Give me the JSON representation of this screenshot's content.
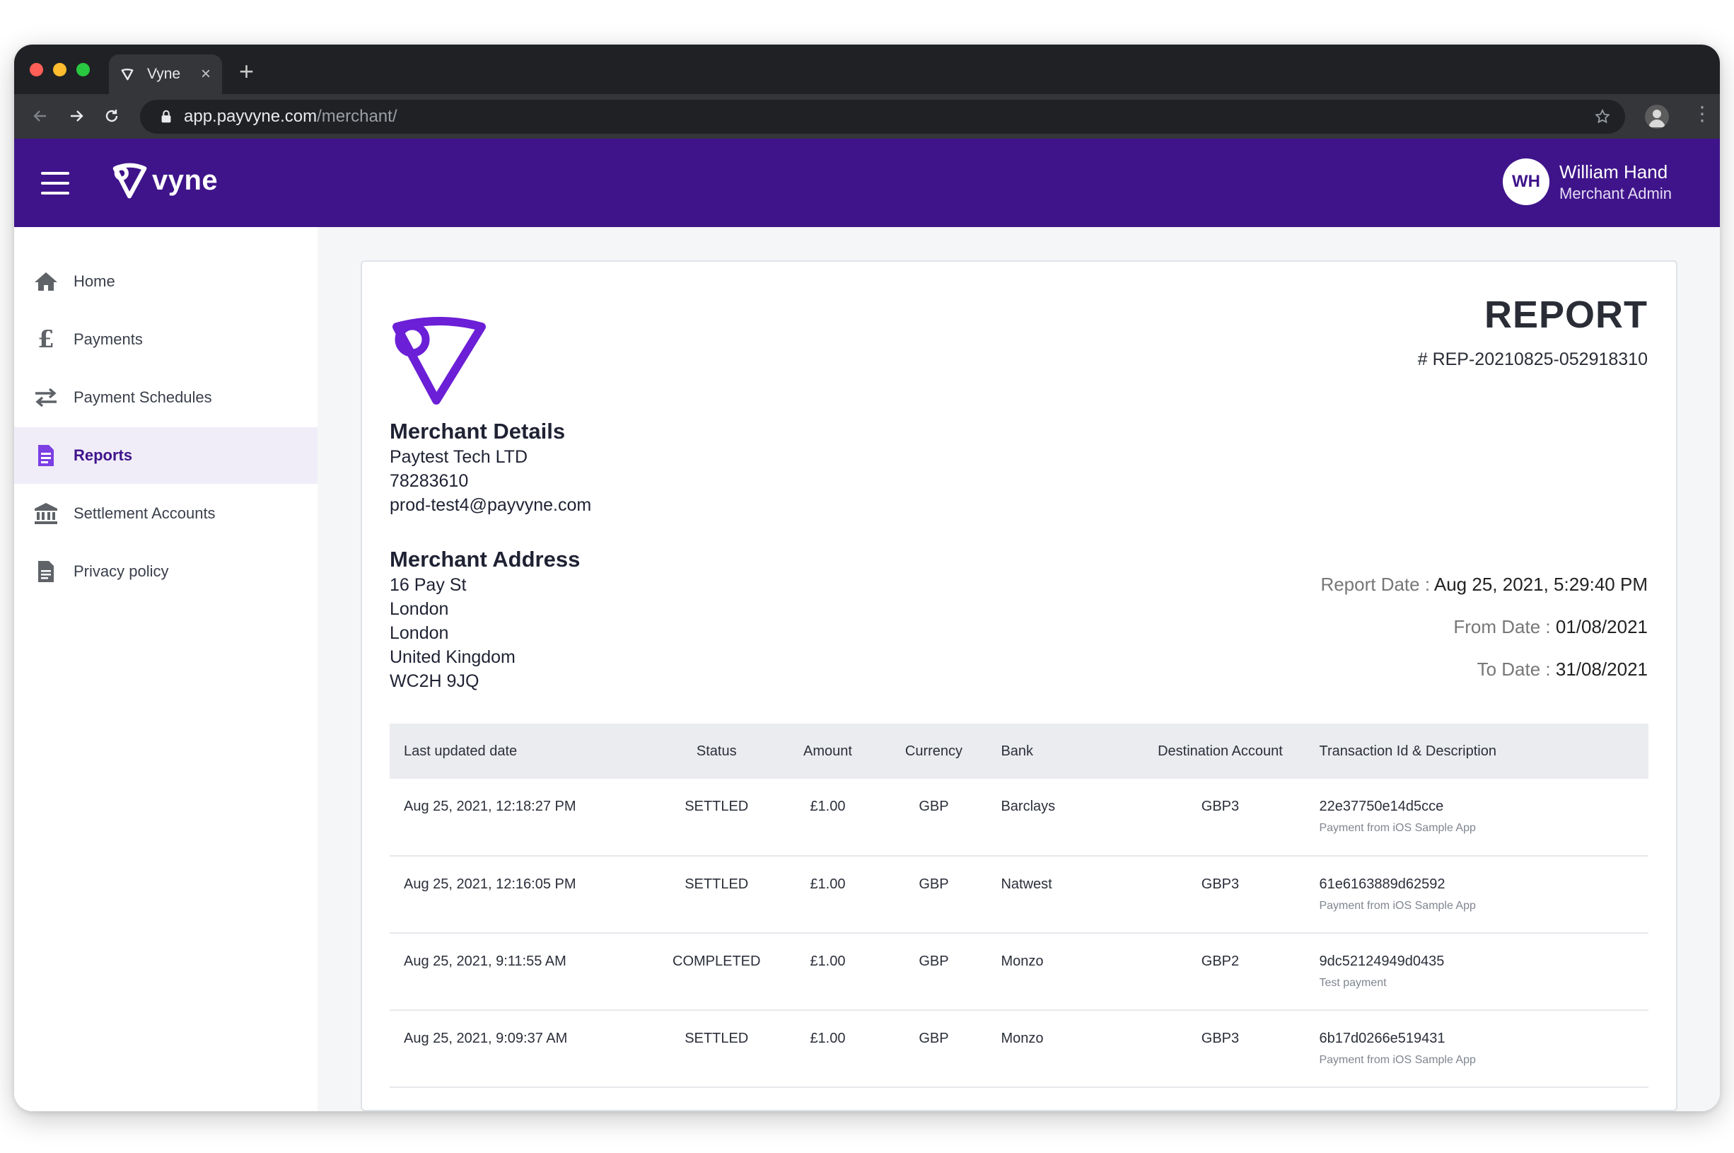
{
  "browser": {
    "tab_title": "Vyne",
    "url_domain": "app.payvyne.com",
    "url_path": "/merchant/"
  },
  "header": {
    "brand": "vyne",
    "user": {
      "initials": "WH",
      "name": "William Hand",
      "role": "Merchant Admin"
    }
  },
  "sidebar": {
    "items": [
      {
        "label": "Home",
        "icon": "home-icon",
        "active": false
      },
      {
        "label": "Payments",
        "icon": "pound-icon",
        "active": false
      },
      {
        "label": "Payment Schedules",
        "icon": "swap-arrows-icon",
        "active": false
      },
      {
        "label": "Reports",
        "icon": "report-document-icon",
        "active": true
      },
      {
        "label": "Settlement Accounts",
        "icon": "bank-icon",
        "active": false
      },
      {
        "label": "Privacy policy",
        "icon": "document-icon",
        "active": false
      }
    ]
  },
  "report": {
    "title": "REPORT",
    "number": "# REP-20210825-052918310",
    "merchant_details": {
      "heading": "Merchant Details",
      "name": "Paytest Tech LTD",
      "id": "78283610",
      "email": "prod-test4@payvyne.com"
    },
    "merchant_address": {
      "heading": "Merchant Address",
      "lines": [
        "16 Pay St",
        "London",
        "London",
        "United Kingdom",
        "WC2H 9JQ"
      ]
    },
    "meta": {
      "report_date_label": "Report Date :",
      "report_date": "Aug 25, 2021, 5:29:40 PM",
      "from_date_label": "From Date :",
      "from_date": "01/08/2021",
      "to_date_label": "To Date :",
      "to_date": "31/08/2021"
    },
    "table": {
      "columns": [
        "Last updated date",
        "Status",
        "Amount",
        "Currency",
        "Bank",
        "Destination Account",
        "Transaction Id & Description"
      ],
      "rows": [
        {
          "date": "Aug 25, 2021, 12:18:27 PM",
          "status": "SETTLED",
          "amount": "£1.00",
          "currency": "GBP",
          "bank": "Barclays",
          "dest": "GBP3",
          "tx_id": "22e37750e14d5cce",
          "desc": "Payment from iOS Sample App"
        },
        {
          "date": "Aug 25, 2021, 12:16:05 PM",
          "status": "SETTLED",
          "amount": "£1.00",
          "currency": "GBP",
          "bank": "Natwest",
          "dest": "GBP3",
          "tx_id": "61e6163889d62592",
          "desc": "Payment from iOS Sample App"
        },
        {
          "date": "Aug 25, 2021, 9:11:55 AM",
          "status": "COMPLETED",
          "amount": "£1.00",
          "currency": "GBP",
          "bank": "Monzo",
          "dest": "GBP2",
          "tx_id": "9dc52124949d0435",
          "desc": "Test payment"
        },
        {
          "date": "Aug 25, 2021, 9:09:37 AM",
          "status": "SETTLED",
          "amount": "£1.00",
          "currency": "GBP",
          "bank": "Monzo",
          "dest": "GBP3",
          "tx_id": "6b17d0266e519431",
          "desc": "Payment from iOS Sample App"
        }
      ]
    }
  },
  "colors": {
    "brand_purple": "#3f148a",
    "logo_purple": "#6b1fd6",
    "active_nav_bg": "#f0edf8"
  }
}
